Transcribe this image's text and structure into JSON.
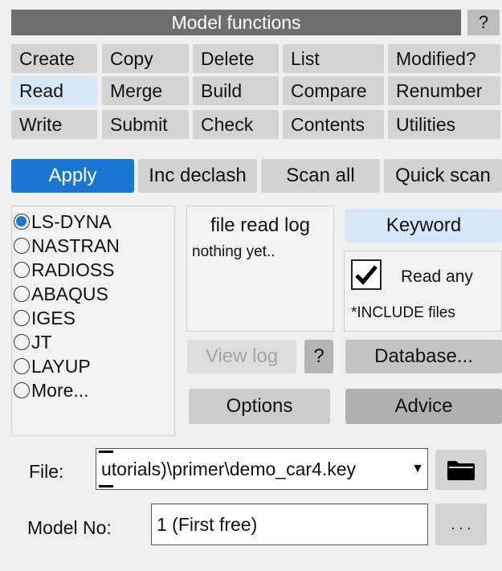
{
  "title": "Model functions",
  "help_label": "?",
  "grid": {
    "row1": [
      "Create",
      "Copy",
      "Delete",
      "List",
      "Modified?"
    ],
    "row2": [
      "Read",
      "Merge",
      "Build",
      "Compare",
      "Renumber"
    ],
    "row3": [
      "Write",
      "Submit",
      "Check",
      "Contents",
      "Utilities"
    ]
  },
  "actions": {
    "apply": "Apply",
    "inc_declash": "Inc declash",
    "scan_all": "Scan all",
    "quick_scan": "Quick scan"
  },
  "formats": {
    "selected": "LS-DYNA",
    "options": [
      "LS-DYNA",
      "NASTRAN",
      "RADIOSS",
      "ABAQUS",
      "IGES",
      "JT",
      "LAYUP",
      "More..."
    ]
  },
  "log": {
    "title": "file read log",
    "text": "nothing yet..",
    "view_log": "View log",
    "help": "?",
    "options": "Options"
  },
  "right": {
    "keyword": "Keyword",
    "read_any_label": "Read any",
    "read_any_checked": true,
    "include_label": "*INCLUDE files",
    "database": "Database...",
    "advice": "Advice"
  },
  "file": {
    "label": "File:",
    "value": "utorials)\\primer\\demo_car4.key"
  },
  "model": {
    "label": "Model No:",
    "value": "1 (First free)",
    "more": ". . ."
  }
}
